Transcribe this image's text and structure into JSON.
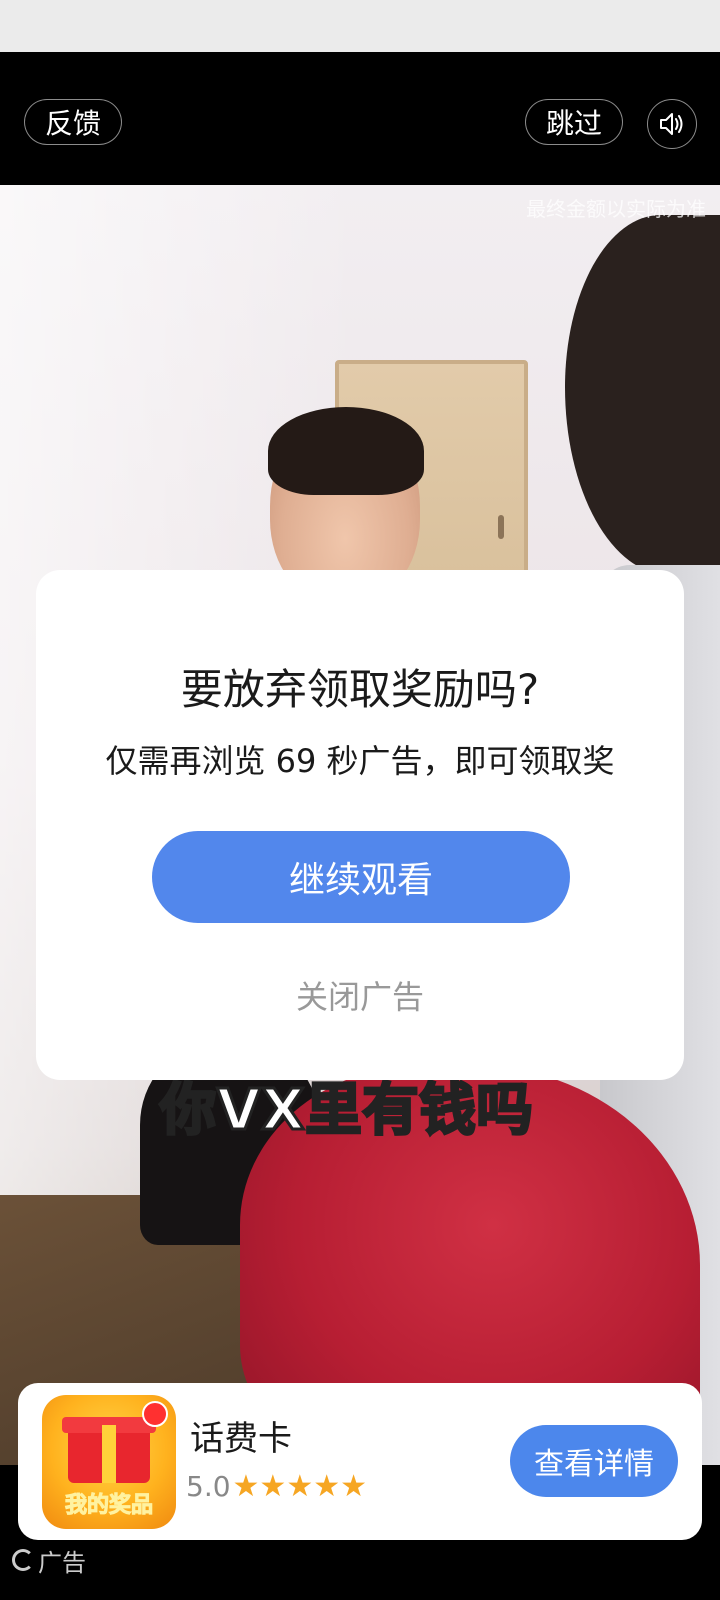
{
  "top_bar": {
    "feedback_label": "反馈",
    "skip_label": "跳过"
  },
  "video": {
    "watermark": "最终金额以实际为准",
    "subtitle": "你VX里有钱吗"
  },
  "dialog": {
    "title": "要放弃领取奖励吗?",
    "description": "仅需再浏览 69 秒广告，即可领取奖",
    "continue_label": "继续观看",
    "close_label": "关闭广告"
  },
  "app_card": {
    "icon_text": "我的奖品",
    "name": "话费卡",
    "rating": "5.0",
    "stars": "★★★★★",
    "detail_label": "查看详情"
  },
  "ad_badge": {
    "label": "广告"
  },
  "colors": {
    "primary_button": "#5287ec",
    "star": "#f6a623"
  }
}
